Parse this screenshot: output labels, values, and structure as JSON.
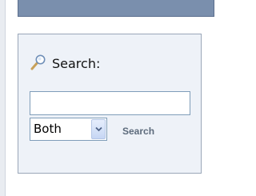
{
  "search_box": {
    "heading": "Search:",
    "input_value": "",
    "scope_selected": "Both",
    "submit_label": "Search"
  },
  "icons": {
    "heading_icon": "magnifier-icon",
    "select_arrow": "chevron-down-icon"
  },
  "colors": {
    "top_bar": "#7a8fad",
    "panel_background": "#eef2f8",
    "panel_border": "#9aa6b8",
    "search_link": "#5d6b7c"
  }
}
